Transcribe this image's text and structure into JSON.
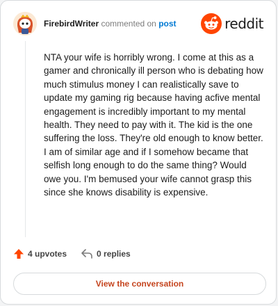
{
  "comment": {
    "author": "FirebirdWriter",
    "action_text": "commented on",
    "post_link": "post",
    "body": "NTA your wife is horribly wrong. I come at this as a gamer and chronically ill person who is debating how much stimulus money I can realistically save to update my gaming rig because having acfive mental engagement is incredibly important to my mental health. They need to pay with it. The kid is the one suffering the loss. They're old enough to know better. I am of similar age and if I somehow became that selfish long enough to do the same thing? Would owe you. I'm bemused your wife cannot grasp this since she knows disability is expensive."
  },
  "brand": {
    "name": "reddit",
    "color": "#ff4500"
  },
  "stats": {
    "upvotes": "4 upvotes",
    "replies": "0 replies"
  },
  "cta": {
    "label": "View the conversation"
  },
  "icons": {
    "avatar": "snoo-avatar",
    "upvote": "upvote-arrow-icon",
    "reply": "reply-arrow-icon",
    "logo": "reddit-logo-icon"
  }
}
